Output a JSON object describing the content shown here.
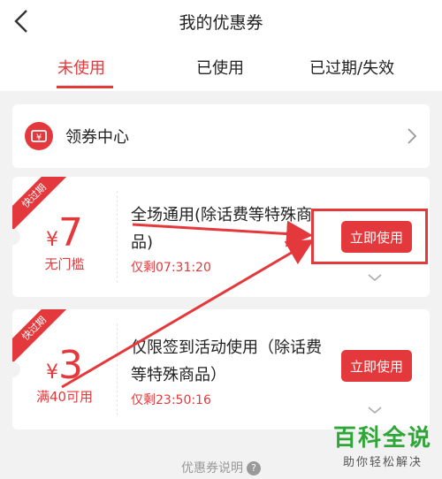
{
  "nav": {
    "title": "我的优惠券"
  },
  "tabs": [
    {
      "label": "未使用",
      "active": true
    },
    {
      "label": "已使用",
      "active": false
    },
    {
      "label": "已过期/失效",
      "active": false
    }
  ],
  "coupon_center": {
    "label": "领券中心",
    "icon": "ticket-icon"
  },
  "coupons": [
    {
      "badge": "快过期",
      "currency": "¥",
      "amount": "7",
      "condition": "无门槛",
      "description": "全场通用(除话费等特殊商品)",
      "remaining": "仅剩07:31:20",
      "button": "立即使用"
    },
    {
      "badge": "快过期",
      "currency": "¥",
      "amount": "3",
      "condition": "满40可用",
      "description": "仅限签到活动使用（除话费等特殊商品）",
      "remaining": "仅剩23:50:16",
      "button": "立即使用"
    }
  ],
  "footer": {
    "explain": "优惠券说明",
    "help_icon": "question-icon"
  },
  "watermark": {
    "main": "百科全说",
    "sub": "助你轻松解决"
  },
  "colors": {
    "accent": "#e4393c",
    "background": "#f2f2f2",
    "watermark": "#2fa638"
  }
}
